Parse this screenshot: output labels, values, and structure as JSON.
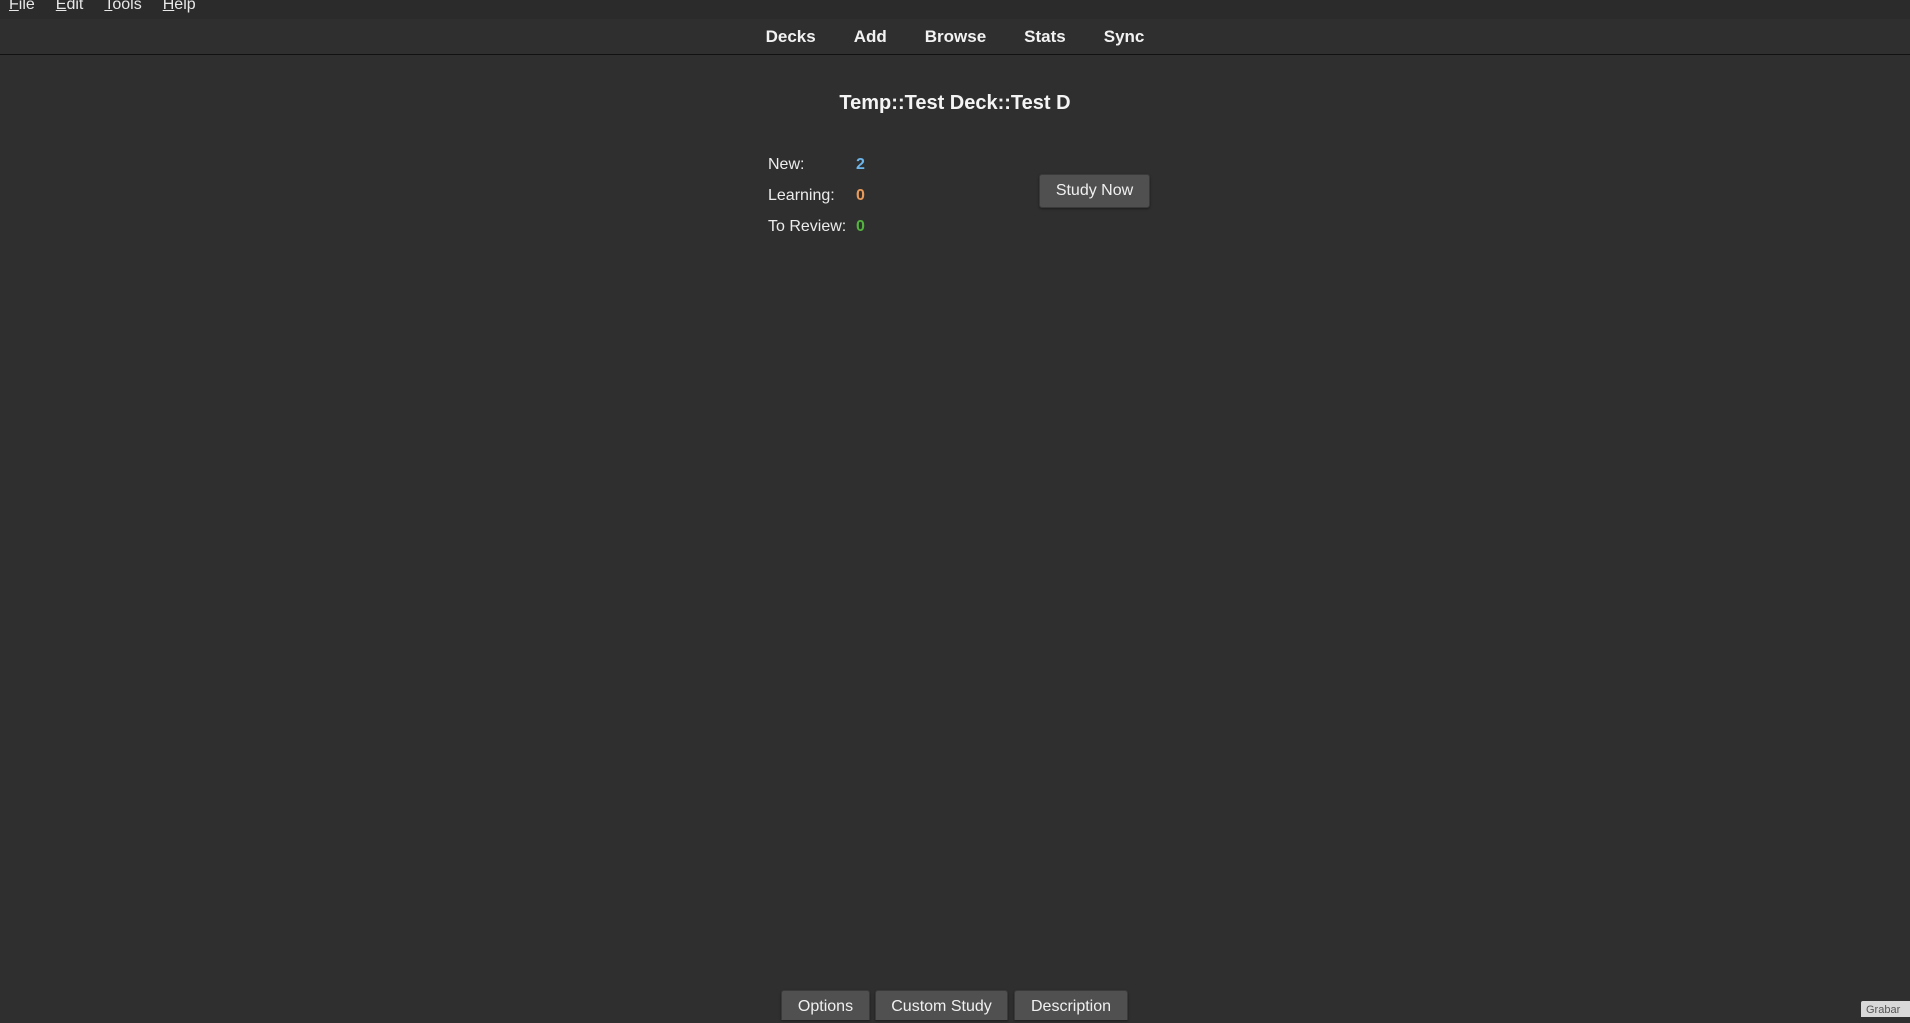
{
  "menubar": {
    "items": [
      {
        "mnemonic": "F",
        "rest": "ile"
      },
      {
        "mnemonic": "E",
        "rest": "dit"
      },
      {
        "mnemonic": "T",
        "rest": "ools"
      },
      {
        "mnemonic": "H",
        "rest": "elp"
      }
    ]
  },
  "toolbar": {
    "decks": "Decks",
    "add": "Add",
    "browse": "Browse",
    "stats": "Stats",
    "sync": "Sync"
  },
  "deck": {
    "title": "Temp::Test Deck::Test D"
  },
  "counts": {
    "new_label": "New:",
    "new_value": "2",
    "learning_label": "Learning:",
    "learning_value": "0",
    "review_label": "To Review:",
    "review_value": "0"
  },
  "colors": {
    "new": "#6cb6ec",
    "learning": "#e89a5a",
    "review": "#53b33f"
  },
  "study_button": "Study Now",
  "bottom": {
    "options": "Options",
    "custom_study": "Custom Study",
    "description": "Description"
  },
  "grabber": "Grabar"
}
